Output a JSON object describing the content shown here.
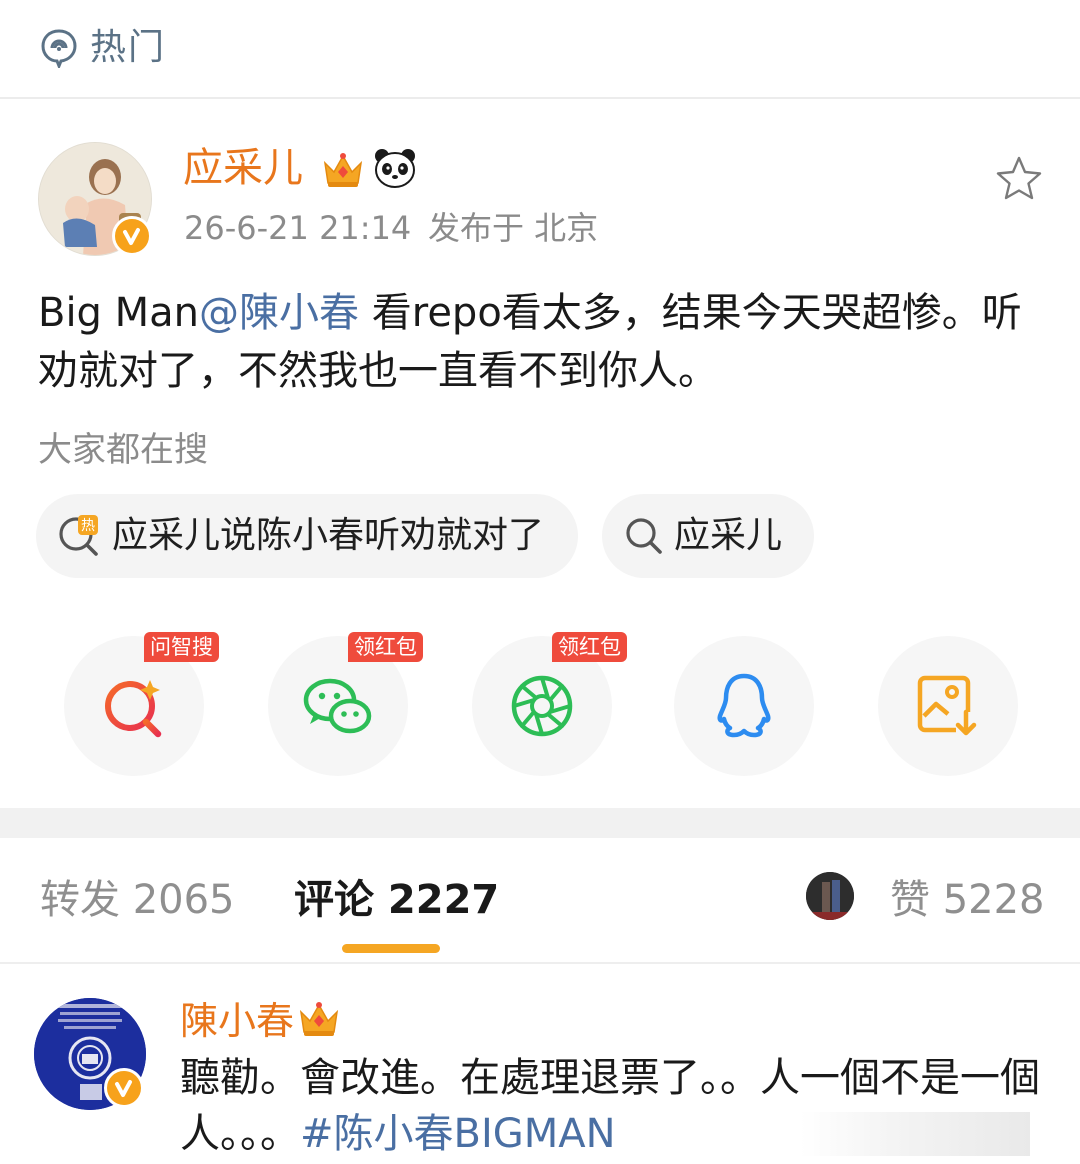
{
  "header": {
    "title": "热门",
    "icon": "hot-topic-icon"
  },
  "post": {
    "author": "应采儿",
    "time": "26-6-21 21:14",
    "location": "发布于 北京",
    "body_prefix": "Big Man",
    "mention": "@陳小春",
    "body_rest": " 看repo看太多，结果今天哭超惨。听劝就对了，不然我也一直看不到你人。"
  },
  "search": {
    "title": "大家都在搜",
    "chips": [
      {
        "label": "应采儿说陈小春听劝就对了",
        "icon": "hot-search-icon"
      },
      {
        "label": "应采儿",
        "icon": "search-icon"
      }
    ]
  },
  "share": {
    "buttons": [
      {
        "name": "ai-search",
        "tag": "问智搜",
        "icon": "ai-search-icon",
        "color": "#f0463a"
      },
      {
        "name": "wechat",
        "tag": "领红包",
        "icon": "wechat-icon",
        "color": "#2dbd56"
      },
      {
        "name": "moments",
        "tag": "领红包",
        "icon": "moments-icon",
        "color": "#2dbd56"
      },
      {
        "name": "qq",
        "tag": "",
        "icon": "qq-icon",
        "color": "#2d8cf0"
      },
      {
        "name": "save-image",
        "tag": "",
        "icon": "save-image-icon",
        "color": "#f5a623"
      }
    ]
  },
  "tabs": {
    "repost": "转发 2065",
    "comment": "评论 2227",
    "like": "赞 5228"
  },
  "comment": {
    "author": "陳小春",
    "body": "聽勸。會改進。在處理退票了。。人一個不是一個人。。。",
    "hashtag": "#陈小春BIGMAN"
  },
  "colors": {
    "name_orange": "#e8761c",
    "link_blue": "#4a6fa3",
    "tab_underline": "#f5a623",
    "badge": "#f7a21b"
  }
}
